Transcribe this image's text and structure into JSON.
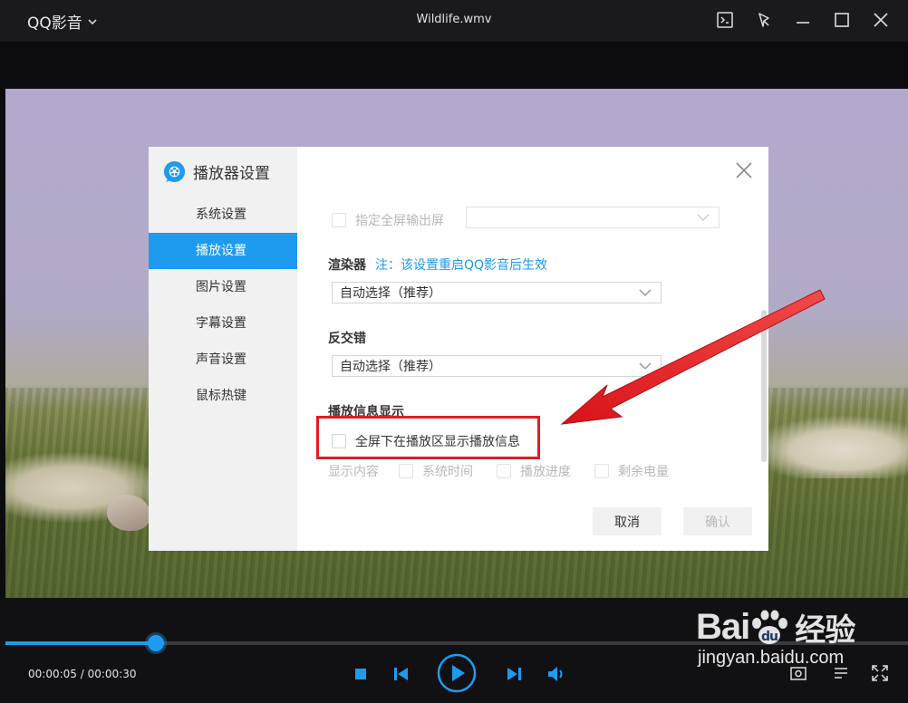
{
  "titlebar": {
    "app_name": "QQ影音",
    "file_title": "Wildlife.wmv"
  },
  "dialog": {
    "title": "播放器设置",
    "nav": [
      "系统设置",
      "播放设置",
      "图片设置",
      "字幕设置",
      "声音设置",
      "鼠标热键"
    ],
    "active_nav": "播放设置",
    "fullscreen_output_label": "指定全屏输出屏",
    "fullscreen_output_value": "",
    "renderer_title": "渲染器",
    "renderer_note": "注：该设置重启QQ影音后生效",
    "renderer_value": "自动选择（推荐）",
    "deinterlace_title": "反交错",
    "deinterlace_value": "自动选择（推荐）",
    "info_title": "播放信息显示",
    "info_fullscreen_label": "全屏下在播放区显示播放信息",
    "show_content_label": "显示内容",
    "opt_time": "系统时间",
    "opt_progress": "播放进度",
    "opt_battery": "剩余电量",
    "cancel_label": "取消",
    "confirm_label": "确认"
  },
  "player": {
    "time_display": "00:00:05 / 00:00:30",
    "progress_fraction": 0.167
  },
  "watermark": {
    "brand": "Bai",
    "brand_cn": "经验",
    "url": "jingyan.baidu.com"
  },
  "colors": {
    "accent": "#1e9bef",
    "annotation_red": "#e01d22"
  }
}
